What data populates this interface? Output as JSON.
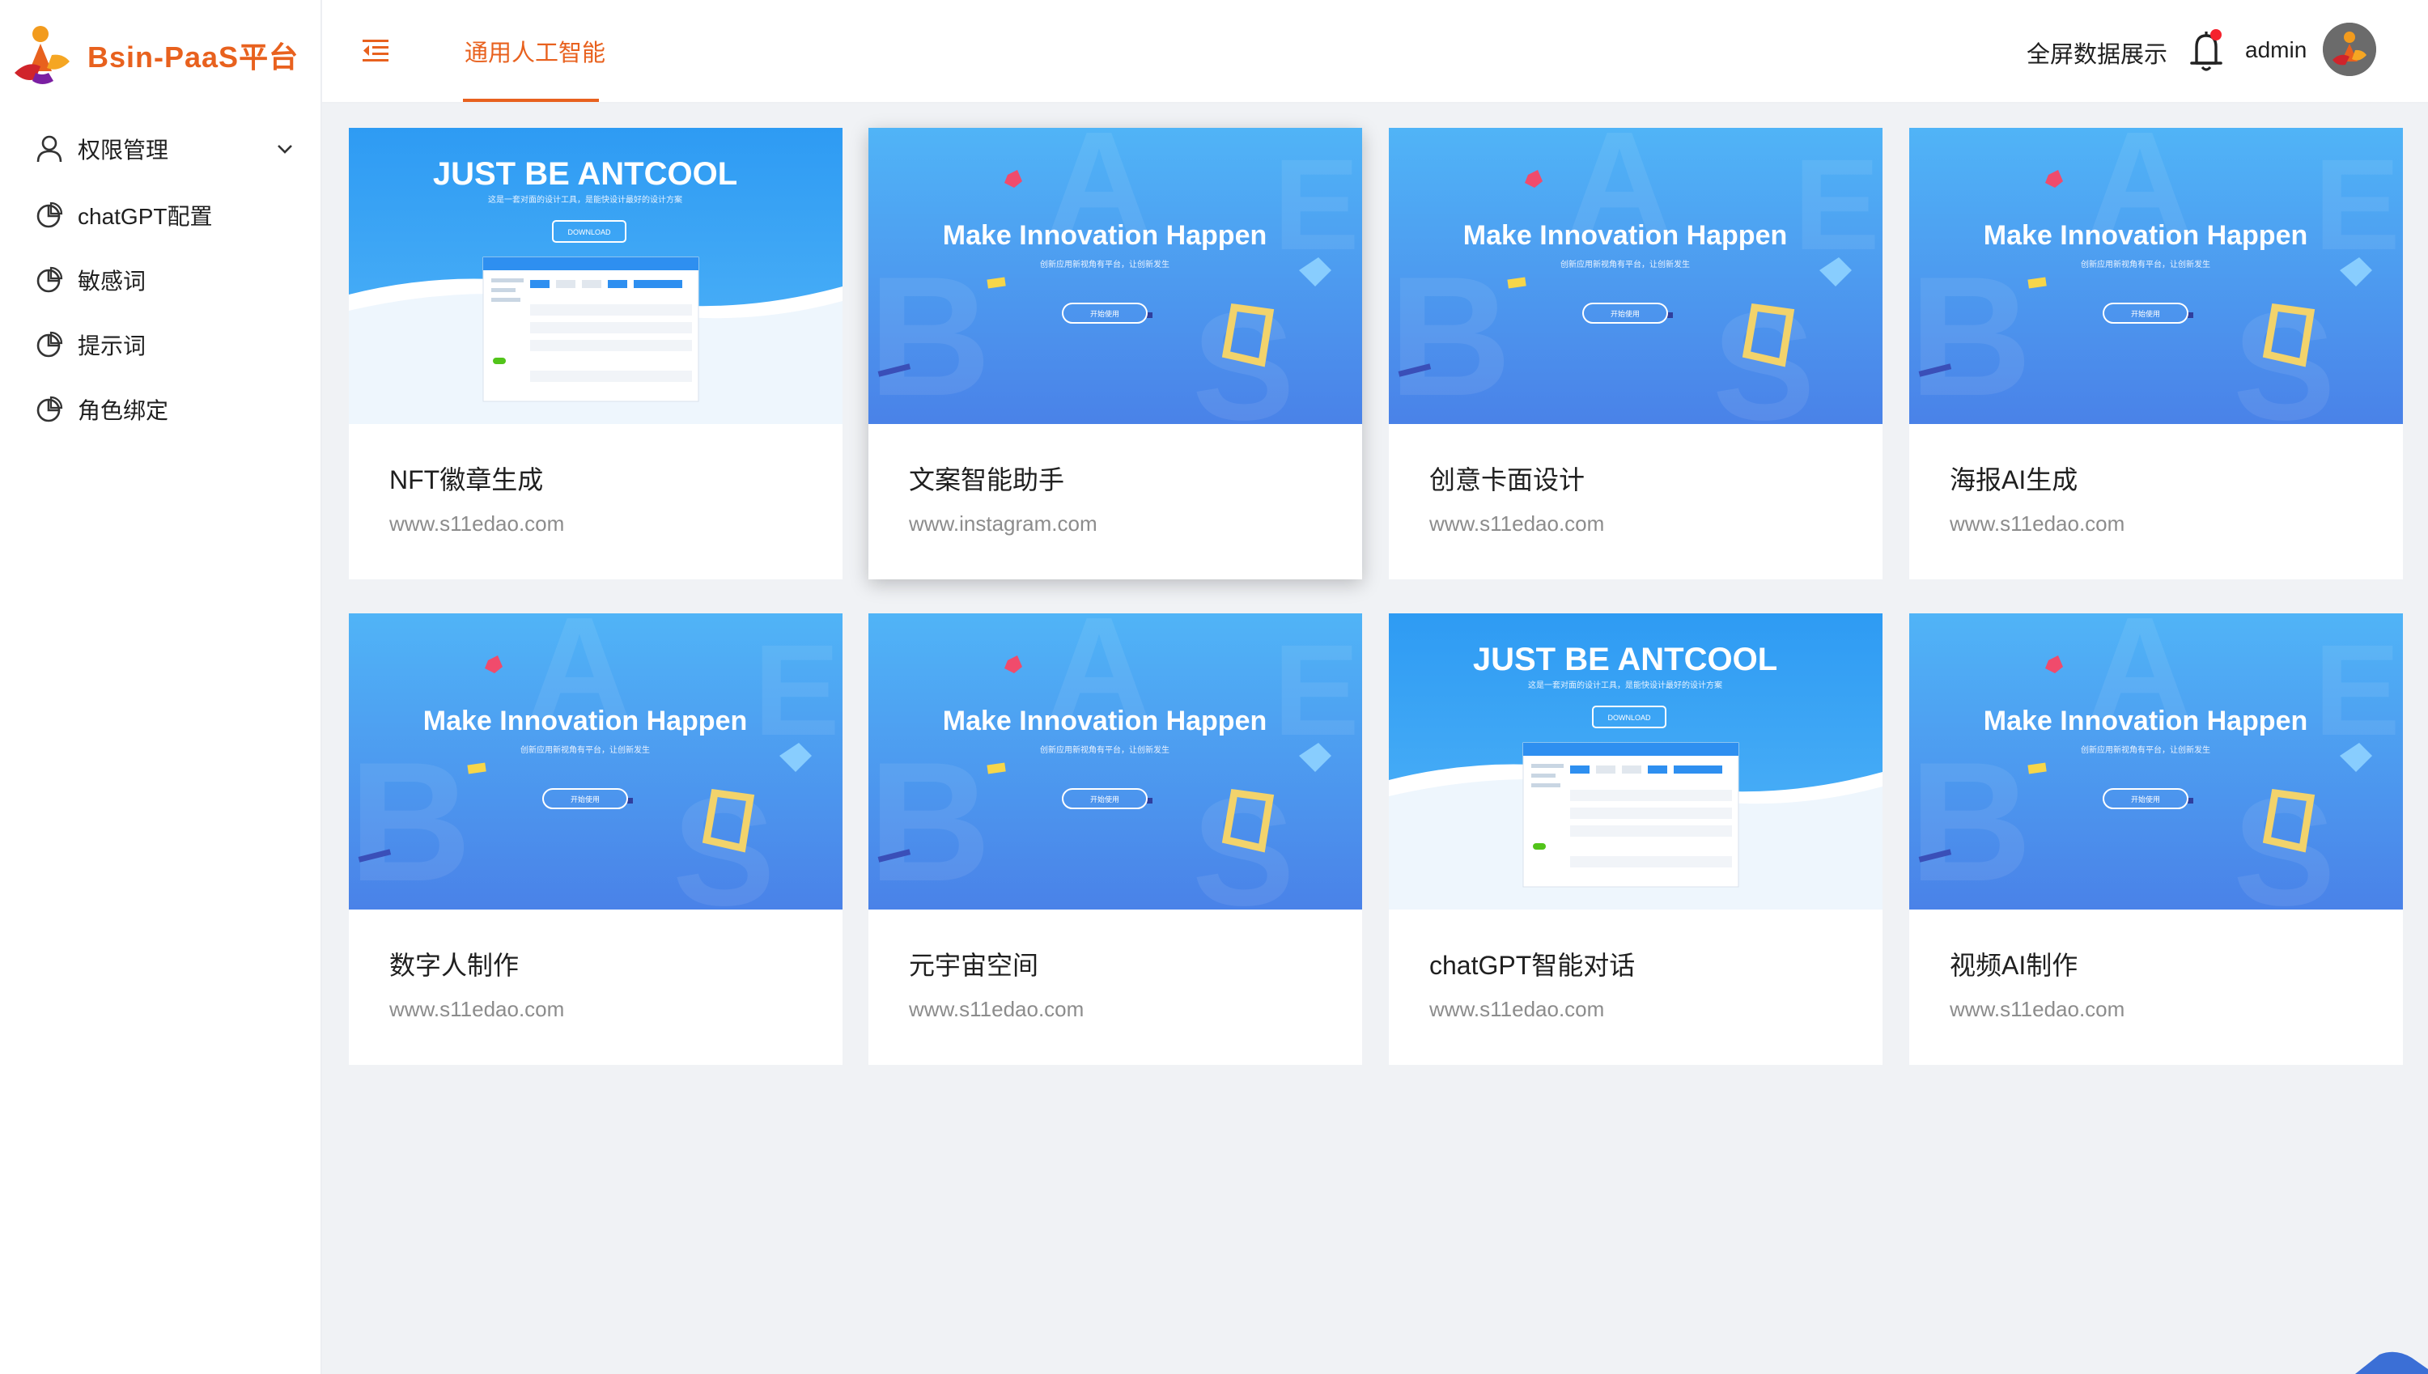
{
  "app": {
    "name": "Bsin-PaaS平台",
    "brand_color": "#e8611e"
  },
  "sidebar": {
    "items": [
      {
        "label": "权限管理",
        "icon": "user-icon",
        "expandable": true
      },
      {
        "label": "chatGPT配置",
        "icon": "pie-chart-icon"
      },
      {
        "label": "敏感词",
        "icon": "pie-chart-icon"
      },
      {
        "label": "提示词",
        "icon": "pie-chart-icon"
      },
      {
        "label": "角色绑定",
        "icon": "pie-chart-icon"
      }
    ]
  },
  "header": {
    "active_tab": "通用人工智能",
    "fullscreen_label": "全屏数据展示",
    "notification_dot_color": "#f5222d",
    "username": "admin"
  },
  "covers": {
    "innovation": {
      "headline": "Make Innovation Happen",
      "subline": "创新应用新视角有平台，让创新发生",
      "button": "开始使用"
    },
    "antcool": {
      "headline": "JUST BE ANTCOOL",
      "subline": "这是一套对面的设计工具，是能快设计最好的设计方案",
      "button": "DOWNLOAD"
    }
  },
  "cards": [
    {
      "title": "NFT徽章生成",
      "description": "www.s11edao.com",
      "cover": "antcool"
    },
    {
      "title": "文案智能助手",
      "description": "www.instagram.com",
      "cover": "innovation"
    },
    {
      "title": "创意卡面设计",
      "description": "www.s11edao.com",
      "cover": "innovation"
    },
    {
      "title": "海报AI生成",
      "description": "www.s11edao.com",
      "cover": "innovation"
    },
    {
      "title": "数字人制作",
      "description": "www.s11edao.com",
      "cover": "innovation"
    },
    {
      "title": "元宇宙空间",
      "description": "www.s11edao.com",
      "cover": "innovation"
    },
    {
      "title": "chatGPT智能对话",
      "description": "www.s11edao.com",
      "cover": "antcool"
    },
    {
      "title": "视频AI制作",
      "description": "www.s11edao.com",
      "cover": "innovation"
    }
  ]
}
